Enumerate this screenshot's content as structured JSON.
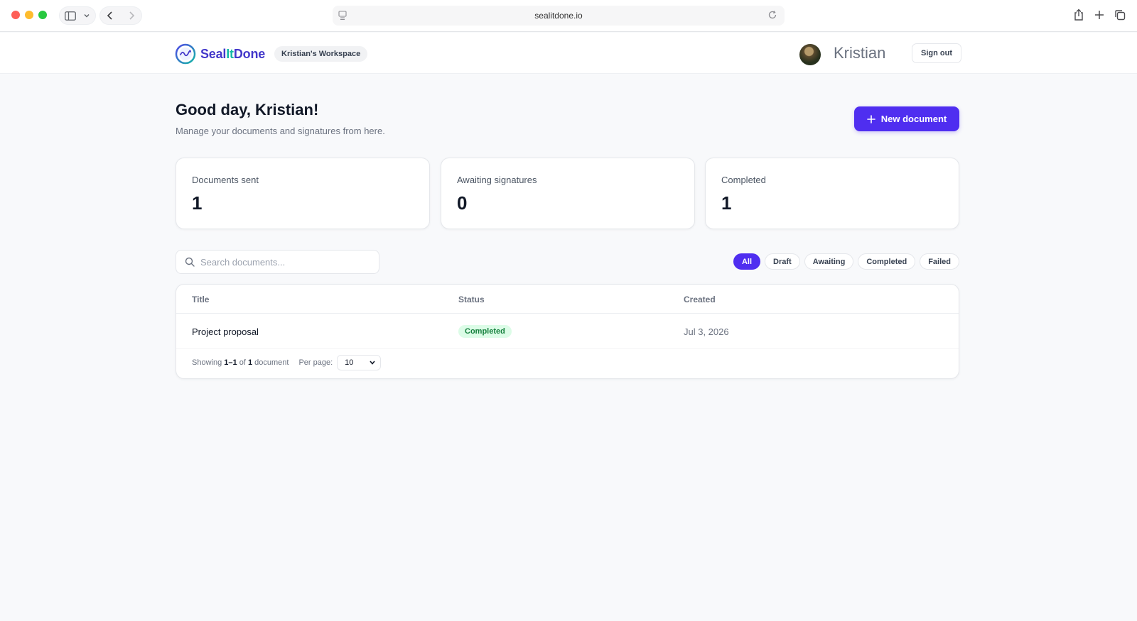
{
  "browser": {
    "url": "sealitdone.io"
  },
  "header": {
    "logo_prefix": "Seal",
    "logo_accent": "It",
    "logo_suffix": "Done",
    "workspace": "Kristian's Workspace",
    "username": "Kristian",
    "signout_label": "Sign out"
  },
  "main": {
    "greeting": "Good day, Kristian!",
    "subtitle": "Manage your documents and signatures from here.",
    "new_document_label": "New document",
    "stats": [
      {
        "label": "Documents sent",
        "value": "1"
      },
      {
        "label": "Awaiting signatures",
        "value": "0"
      },
      {
        "label": "Completed",
        "value": "1"
      }
    ],
    "search_placeholder": "Search documents...",
    "filters": [
      "All",
      "Draft",
      "Awaiting",
      "Completed",
      "Failed"
    ],
    "active_filter": "All"
  },
  "table": {
    "columns": [
      "Title",
      "Status",
      "Created"
    ],
    "rows": [
      {
        "title": "Project proposal",
        "status": "Completed",
        "created": "Jul 3, 2026"
      }
    ],
    "footer": {
      "showing_prefix": "Showing",
      "range": "1–1",
      "of_text": "of",
      "total": "1",
      "unit": "document",
      "per_page_label": "Per page:",
      "per_page_value": "10"
    }
  },
  "colors": {
    "primary": "#4f2ef0",
    "success_bg": "#dcfce7",
    "success_text": "#15803d"
  }
}
